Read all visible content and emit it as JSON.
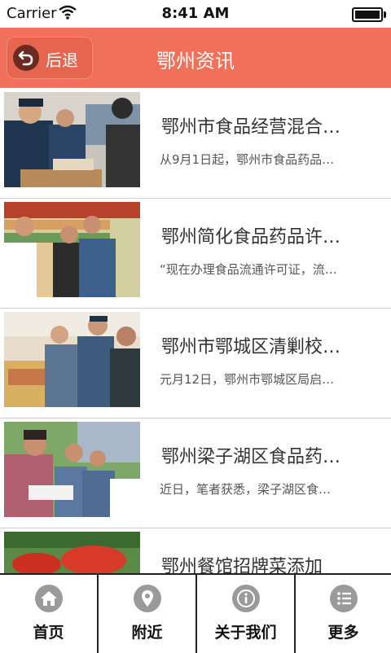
{
  "status_bar": {
    "carrier": "Carrier",
    "time": "8:41 AM"
  },
  "header": {
    "back_label": "后退",
    "title": "鄂州资讯"
  },
  "news": [
    {
      "title": "鄂州市食品经营混合…",
      "summary": "从9月1日起，鄂州市食品药品…"
    },
    {
      "title": "鄂州简化食品药品许…",
      "summary": "“现在办理食品流通许可证，流…"
    },
    {
      "title": "鄂州市鄂城区清剿校…",
      "summary": "元月12日，鄂州市鄂城区局启…"
    },
    {
      "title": "鄂州梁子湖区食品药…",
      "summary": "近日，笔者获悉，梁子湖区食…"
    },
    {
      "title": "鄂州餐馆招牌菜添加",
      "summary": ""
    }
  ],
  "tabs": [
    {
      "label": "首页",
      "icon": "home-icon"
    },
    {
      "label": "附近",
      "icon": "location-pin-icon"
    },
    {
      "label": "关于我们",
      "icon": "info-icon"
    },
    {
      "label": "更多",
      "icon": "list-icon"
    }
  ],
  "colors": {
    "nav_bar": "#f0705a",
    "back_button": "#e6654f",
    "tab_icon": "#9a9a9a"
  }
}
